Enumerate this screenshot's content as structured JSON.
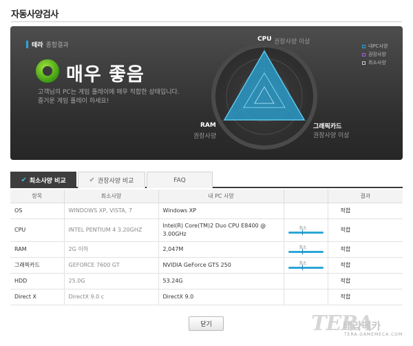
{
  "title": "자동사양검사",
  "summary": {
    "app_name": "테라",
    "label": "종합결과",
    "result": "매우 좋음",
    "desc_line1": "고객님의 PC는 게임 플레이에 매우 적합한 상태입니다.",
    "desc_line2": "즐거운 게임 플레이 하세요!"
  },
  "radar": {
    "axes": [
      {
        "title": "CPU",
        "sub": "권장사양 이상"
      },
      {
        "title": "그래픽카드",
        "sub": "권장사양 이상"
      },
      {
        "title": "RAM",
        "sub": "권장사양"
      }
    ],
    "legend": [
      {
        "label": "내PC사양",
        "color": "#2aa5d8"
      },
      {
        "label": "권장사양",
        "color": "#a066d8"
      },
      {
        "label": "최소사양",
        "color": "#cccccc"
      }
    ]
  },
  "tabs": [
    "최소사양 비교",
    "권장사양 비교",
    "FAQ"
  ],
  "table": {
    "headers": [
      "항목",
      "최소사양",
      "내 PC 사양",
      "",
      "결과"
    ],
    "rows": [
      {
        "item": "OS",
        "min": "WINDOWS XP, VISTA, 7",
        "mine_l1": "Windows XP",
        "mine_l2": "",
        "gauge": "",
        "result": "적합"
      },
      {
        "item": "CPU",
        "min": "INTEL PENTIUM 4 3.20GHZ",
        "mine_l1": "Intel(R) Core(TM)2 Duo CPU E8400 @",
        "mine_l2": "3.00GHz",
        "gauge": "최소",
        "result": "적합"
      },
      {
        "item": "RAM",
        "min": "2G 이하",
        "mine_l1": "2,047M",
        "mine_l2": "",
        "gauge": "최소",
        "result": "적합"
      },
      {
        "item": "그래픽카드",
        "min": "GEFORCE 7600 GT",
        "mine_l1": "NVIDIA GeForce GTS 250",
        "mine_l2": "",
        "gauge": "최소",
        "result": "적합"
      },
      {
        "item": "HDD",
        "min": "25.0G",
        "mine_l1": "53.24G",
        "mine_l2": "",
        "gauge": "",
        "result": "적합"
      },
      {
        "item": "Direct X",
        "min": "DirectX 9.0 c",
        "mine_l1": "DirectX 9.0",
        "mine_l2": "",
        "gauge": "",
        "result": "적합"
      }
    ]
  },
  "close_label": "닫기",
  "logo": {
    "main": "TERA",
    "kr": "테라메카",
    "sub": "TERA.GAMEMECA.COM"
  }
}
